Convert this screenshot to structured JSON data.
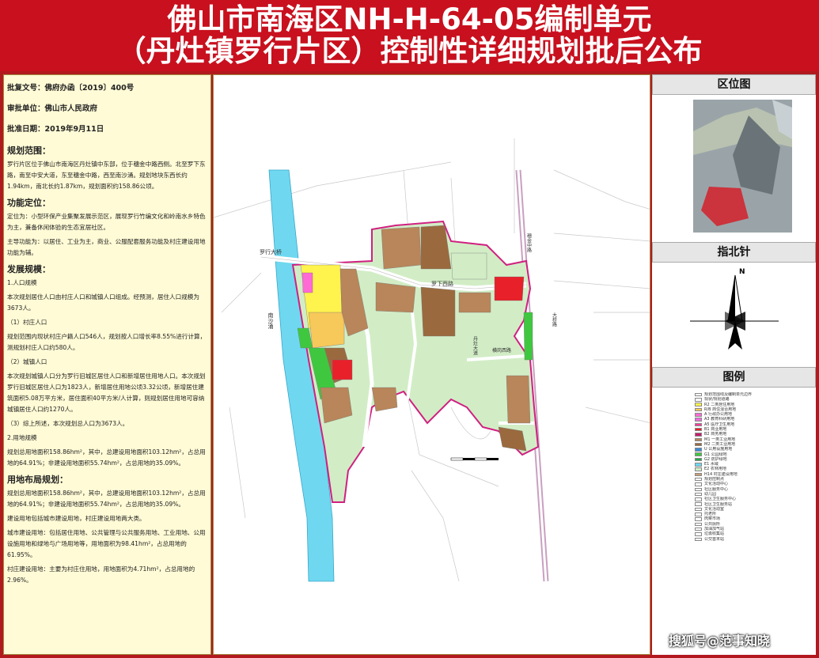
{
  "header": {
    "line1": "佛山市南海区NH-H-64-05编制单元",
    "line2": "（丹灶镇罗行片区）控制性详细规划批后公布"
  },
  "approval": {
    "doc_no": "批复文号：佛府办函〔2019〕400号",
    "unit": "审批单位：佛山市人民政府",
    "date": "批准日期：2019年9月11日"
  },
  "sections": {
    "scope_title": "规划范围：",
    "scope_text": "罗行片区位于佛山市南海区丹灶镇中东部，位于穗金中路西侧。北至罗下东路，南至中安大道，东至穗金中路，西至南沙涌。规划地块东西长约1.94km，南北长约1.87km，规划面积约158.86公顷。",
    "function_title": "功能定位：",
    "function_text1": "定位为：小型环保产业集聚发展示范区，展现罗行竹编文化和岭南水乡特色为主，兼备休闲体验的生态宜居社区。",
    "function_text2": "主导功能为：以居住、工业为主，商业、公服配套服务功能及村庄建设用地功能为辅。",
    "dev_title": "发展规模：",
    "dev_p1": "1.人口规模",
    "dev_p2": "本次规划居住人口由村庄人口和城镇人口组成。经预测，居住人口规模为3673人。",
    "dev_p3": "（1）村庄人口",
    "dev_p4": "规划范围内现状村庄户籍人口546人，规划按人口增长率8.55%进行计算，测规划村庄人口约580人。",
    "dev_p5": "（2）城镇人口",
    "dev_p6": "本次规划城镇人口分为罗行旧城区居住人口和新增居住用地人口。本次规划罗行旧城区居住人口为1823人，新增居住用地公顷3.32公顷，新增居住建筑面积5.08万平方米，居住面积40平方米/人计算，则规划居住用地可容纳城镇居住人口约1270人。",
    "dev_p7": "（3）综上所述，本次规划总人口为3673人。",
    "dev_p8": "2.用地规模",
    "dev_p9": "规划总用地面积158.86hm²，其中，总建设用地面积103.12hm²，占总用地的64.91%；非建设用地面积55.74hm²，占总用地的35.09%。",
    "layout_title": "用地布局规划：",
    "layout_p1": "规划总用地面积158.86hm²，其中，总建设用地面积103.12hm²，占总用地的64.91%；非建设用地面积55.74hm²，占总用地的35.09%。",
    "layout_p2": "建设用地包括城市建设用地，村庄建设用地两大类。",
    "layout_p3": "城市建设用地：包括居住用地、公共管理与公共服务用地、工业用地、公用设施用地和绿地与广场用地等，用地面积为98.41hm²，占总用地的61.95%。",
    "layout_p4": "村庄建设用地：主要为村庄住用地，用地面积为4.71hm²，占总用地的2.96%。"
  },
  "right": {
    "loc_title": "区位图",
    "north_title": "指北针",
    "north_label": "N",
    "legend_title": "图例"
  },
  "map_labels": {
    "road1": "罗行大桥",
    "road2": "罗下西路",
    "road3": "丹灶大道",
    "road4": "穗金中路",
    "road5": "横岗西路",
    "river": "南沙涌",
    "bridge": "大桥路"
  },
  "legend_items": [
    {
      "label": "规划范围线及编制单元边界",
      "color": "#ffffff"
    },
    {
      "label": "现状/规划道路",
      "color": "#ffffff"
    },
    {
      "label": "R2 二类居住用地",
      "color": "#fff34d"
    },
    {
      "label": "R/B 商住混合用地",
      "color": "#f7c85a"
    },
    {
      "label": "A 行政办公用地",
      "color": "#ff6ad5"
    },
    {
      "label": "A3 教育科研用地",
      "color": "#f06be0"
    },
    {
      "label": "A5 医疗卫生用地",
      "color": "#ff3b9a"
    },
    {
      "label": "B1 商业用地",
      "color": "#e8202a"
    },
    {
      "label": "B2 商务用地",
      "color": "#c81a6a"
    },
    {
      "label": "M1 一类工业用地",
      "color": "#b8865a"
    },
    {
      "label": "M2 二类工业用地",
      "color": "#9a6a3e"
    },
    {
      "label": "U 公用设施用地",
      "color": "#3a8ad8"
    },
    {
      "label": "G1 公园绿地",
      "color": "#3fc83f"
    },
    {
      "label": "G2 防护绿地",
      "color": "#2aa84a"
    },
    {
      "label": "E1 水域",
      "color": "#6fd8f0"
    },
    {
      "label": "E2 农林用地",
      "color": "#d2edc6"
    },
    {
      "label": "H14 村庄建设用地",
      "color": "#c8a078"
    },
    {
      "label": "规划控制点",
      "color": "#ffffff"
    },
    {
      "label": "文化活动中心",
      "color": "#ffffff"
    },
    {
      "label": "社区服务中心",
      "color": "#ffffff"
    },
    {
      "label": "幼儿园",
      "color": "#ffffff"
    },
    {
      "label": "社区卫生服务中心",
      "color": "#ffffff"
    },
    {
      "label": "社区卫生服务站",
      "color": "#ffffff"
    },
    {
      "label": "文化活动室",
      "color": "#ffffff"
    },
    {
      "label": "托老所",
      "color": "#ffffff"
    },
    {
      "label": "肉菜市场",
      "color": "#ffffff"
    },
    {
      "label": "公共厕所",
      "color": "#ffffff"
    },
    {
      "label": "加油加气站",
      "color": "#ffffff"
    },
    {
      "label": "垃圾收集站",
      "color": "#ffffff"
    },
    {
      "label": "公交首末站",
      "color": "#ffffff"
    }
  ],
  "watermark": "搜狐号@范事知晓",
  "colors": {
    "banner": "#c8101e",
    "residential": "#fff34d",
    "industrial": "#b8865a",
    "green": "#3fc83f",
    "water": "#6fd8f0",
    "farmland": "#d2edc6",
    "commercial": "#e8202a",
    "boundary": "#d02080"
  }
}
